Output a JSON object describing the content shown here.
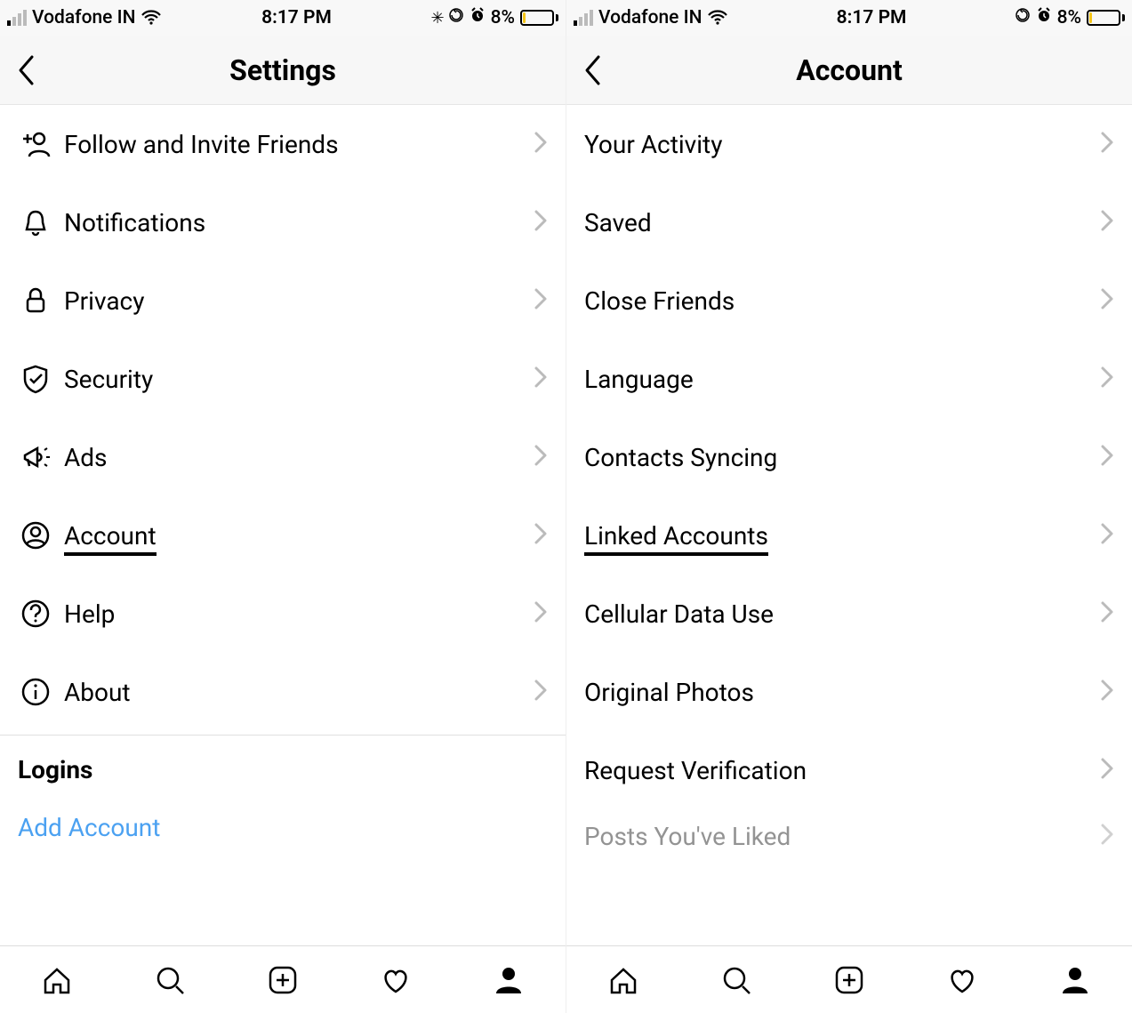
{
  "left": {
    "status": {
      "carrier": "Vodafone IN",
      "time": "8:17 PM",
      "battery": "8%"
    },
    "title": "Settings",
    "items": [
      {
        "label": "Follow and Invite Friends",
        "icon": "add-friend-icon"
      },
      {
        "label": "Notifications",
        "icon": "bell-icon"
      },
      {
        "label": "Privacy",
        "icon": "lock-icon"
      },
      {
        "label": "Security",
        "icon": "shield-check-icon"
      },
      {
        "label": "Ads",
        "icon": "megaphone-icon"
      },
      {
        "label": "Account",
        "icon": "user-circle-icon",
        "highlighted": true
      },
      {
        "label": "Help",
        "icon": "question-circle-icon"
      },
      {
        "label": "About",
        "icon": "info-circle-icon"
      }
    ],
    "section_title": "Logins",
    "add_account": "Add Account"
  },
  "right": {
    "status": {
      "carrier": "Vodafone IN",
      "time": "8:17 PM",
      "battery": "8%"
    },
    "title": "Account",
    "items": [
      {
        "label": "Your Activity"
      },
      {
        "label": "Saved"
      },
      {
        "label": "Close Friends"
      },
      {
        "label": "Language"
      },
      {
        "label": "Contacts Syncing"
      },
      {
        "label": "Linked Accounts",
        "highlighted": true
      },
      {
        "label": "Cellular Data Use"
      },
      {
        "label": "Original Photos"
      },
      {
        "label": "Request Verification"
      },
      {
        "label": "Posts You've Liked"
      }
    ]
  }
}
